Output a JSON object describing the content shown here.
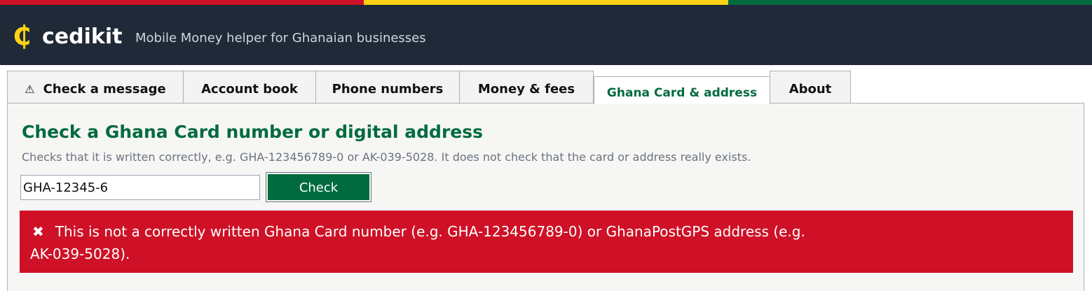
{
  "colors": {
    "flag_red": "#ce1126",
    "flag_gold": "#fcd116",
    "flag_green": "#006b3f",
    "header_bg": "#1f2937",
    "accent_green": "#006b3f",
    "error_red": "#ce1126"
  },
  "header": {
    "logo_symbol": "₵",
    "logo_name": "cedikit",
    "tagline": "Mobile Money helper for Ghanaian businesses"
  },
  "tabs": [
    {
      "icon": "⚠",
      "icon_name": "warning-icon",
      "label": "Check a message",
      "active": false
    },
    {
      "label": "Account book",
      "active": false
    },
    {
      "label": "Phone numbers",
      "active": false
    },
    {
      "label": "Money & fees",
      "active": false
    },
    {
      "label": "Ghana Card & address",
      "active": true
    },
    {
      "label": "About",
      "active": false
    }
  ],
  "main": {
    "title": "Check a Ghana Card number or digital address",
    "description": "Checks that it is written correctly, e.g. GHA-123456789-0 or AK-039-5028. It does not check that the card or address really exists.",
    "input_value": "GHA-12345-6",
    "check_button_label": "Check",
    "error": {
      "icon": "✖",
      "icon_name": "cross-icon",
      "line1": "This is not a correctly written Ghana Card number (e.g. GHA-123456789-0) or GhanaPostGPS address (e.g.",
      "line2": "AK-039-5028)."
    }
  }
}
